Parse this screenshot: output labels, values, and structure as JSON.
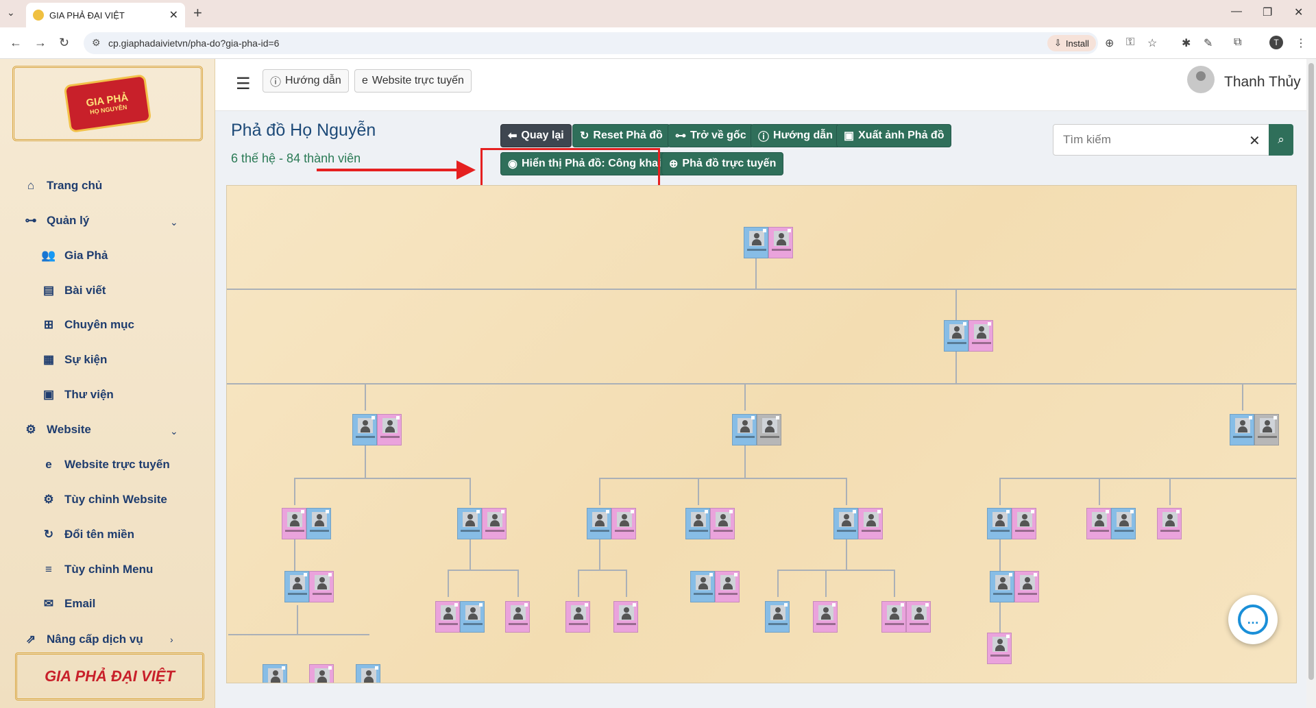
{
  "browser": {
    "tab_title": "GIA PHẢ ĐẠI VIỆT",
    "url": "cp.giaphadaivietvn/pha-do?gia-pha-id=6",
    "install_label": "Install",
    "profile_letter": "T"
  },
  "sidebar": {
    "logo_text": "GIA PHẢ",
    "logo_sub": "HỌ NGUYỄN",
    "items": [
      {
        "label": "Trang chủ",
        "icon": "home-icon"
      },
      {
        "label": "Quản lý",
        "icon": "sitemap-icon"
      },
      {
        "label": "Gia Phả",
        "icon": "users-icon"
      },
      {
        "label": "Bài viết",
        "icon": "newspaper-icon"
      },
      {
        "label": "Chuyên mục",
        "icon": "grid-icon"
      },
      {
        "label": "Sự kiện",
        "icon": "calendar-icon"
      },
      {
        "label": "Thư viện",
        "icon": "images-icon"
      },
      {
        "label": "Website",
        "icon": "gear-icon"
      },
      {
        "label": "Website trực tuyến",
        "icon": "edge-icon"
      },
      {
        "label": "Tùy chỉnh Website",
        "icon": "gear-icon"
      },
      {
        "label": "Đổi tên miền",
        "icon": "refresh-icon"
      },
      {
        "label": "Tùy chỉnh Menu",
        "icon": "menu-icon"
      },
      {
        "label": "Email",
        "icon": "envelope-icon"
      },
      {
        "label": "Nâng cấp dịch vụ",
        "icon": "upgrade-icon"
      }
    ],
    "bottom_logo": "GIA PHẢ ĐẠI VIỆT"
  },
  "topbar": {
    "guide_label": "Hướng dẫn",
    "website_label": "Website trực tuyến",
    "user_name": "Thanh Thủy"
  },
  "main": {
    "title": "Phả đồ Họ Nguyễn",
    "subtitle": "6 thế hệ - 84 thành viên",
    "buttons": {
      "back": "Quay lại",
      "reset": "Reset Phả đồ",
      "root": "Trở về gốc",
      "guide": "Hướng dẫn",
      "export": "Xuất ảnh Phả đồ",
      "display": "Hiển thị Phả đồ: Công khai",
      "online": "Phả đồ trực tuyến"
    },
    "search_placeholder": "Tìm kiếm"
  },
  "colors": {
    "accent": "#2f6f5a",
    "highlight": "#e52020",
    "male": "#87bde6",
    "female": "#eaa3dc"
  }
}
